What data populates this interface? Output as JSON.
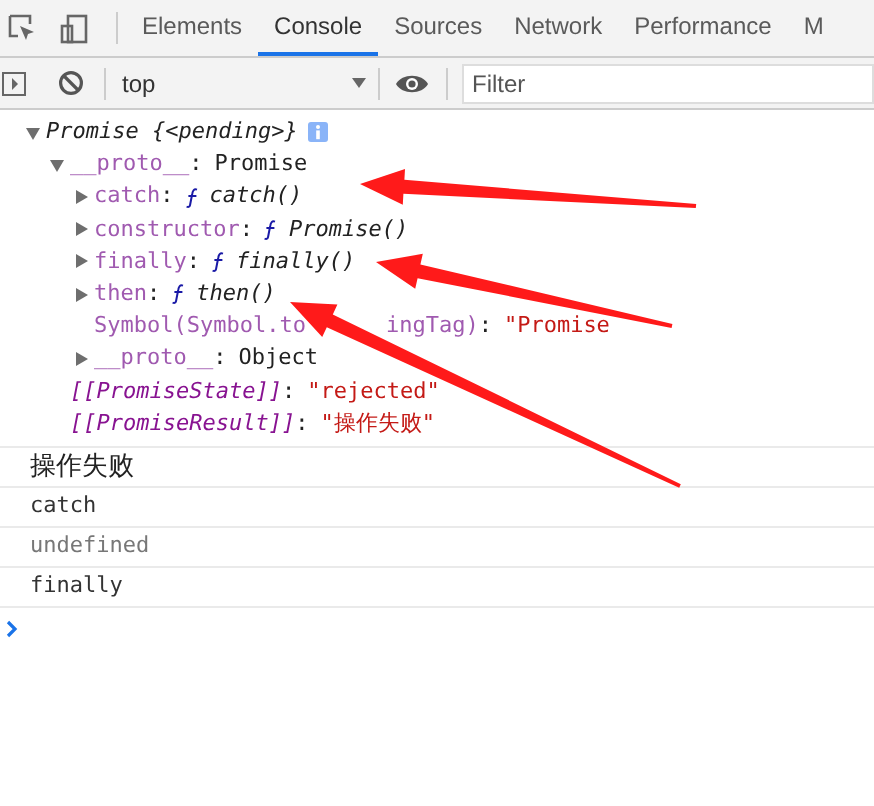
{
  "tabs": [
    {
      "label": "Elements",
      "selected": false
    },
    {
      "label": "Console",
      "selected": true
    },
    {
      "label": "Sources",
      "selected": false
    },
    {
      "label": "Network",
      "selected": false
    },
    {
      "label": "Performance",
      "selected": false
    },
    {
      "label": "M",
      "selected": false
    }
  ],
  "toolbar": {
    "context": "top",
    "filter_placeholder": "Filter"
  },
  "object": {
    "label": "Promise {<pending>}",
    "expanded": true,
    "children": [
      {
        "key": "__proto__",
        "separator": ":",
        "value": "Promise",
        "kind": "object",
        "expanded": true,
        "children": [
          {
            "key": "catch",
            "separator": ":",
            "value": "catch()",
            "kind": "function",
            "expanded": false
          },
          {
            "key": "constructor",
            "separator": ":",
            "value": "Promise()",
            "kind": "function",
            "expanded": false
          },
          {
            "key": "finally",
            "separator": ":",
            "value": "finally()",
            "kind": "function",
            "expanded": false
          },
          {
            "key": "then",
            "separator": ":",
            "value": "then()",
            "kind": "function",
            "expanded": false
          },
          {
            "key_parts": [
              "Symbol(Symbol.to",
              "ingTag)"
            ],
            "separator": ":",
            "value": "\"Promise",
            "kind": "string"
          },
          {
            "key": "__proto__",
            "separator": ":",
            "value": "Object",
            "kind": "object",
            "expanded": false
          }
        ]
      },
      {
        "key": "[[PromiseState]]",
        "separator": ":",
        "value": "\"rejected\"",
        "kind": "string",
        "internal": true
      },
      {
        "key": "[[PromiseResult]]",
        "separator": ":",
        "value": "\"操作失败\"",
        "kind": "string",
        "internal": true
      }
    ]
  },
  "messages": [
    {
      "text": "操作失败",
      "kind": "cjk"
    },
    {
      "text": "catch",
      "kind": "log"
    },
    {
      "text": "undefined",
      "kind": "undefined"
    },
    {
      "text": "finally",
      "kind": "log"
    }
  ]
}
